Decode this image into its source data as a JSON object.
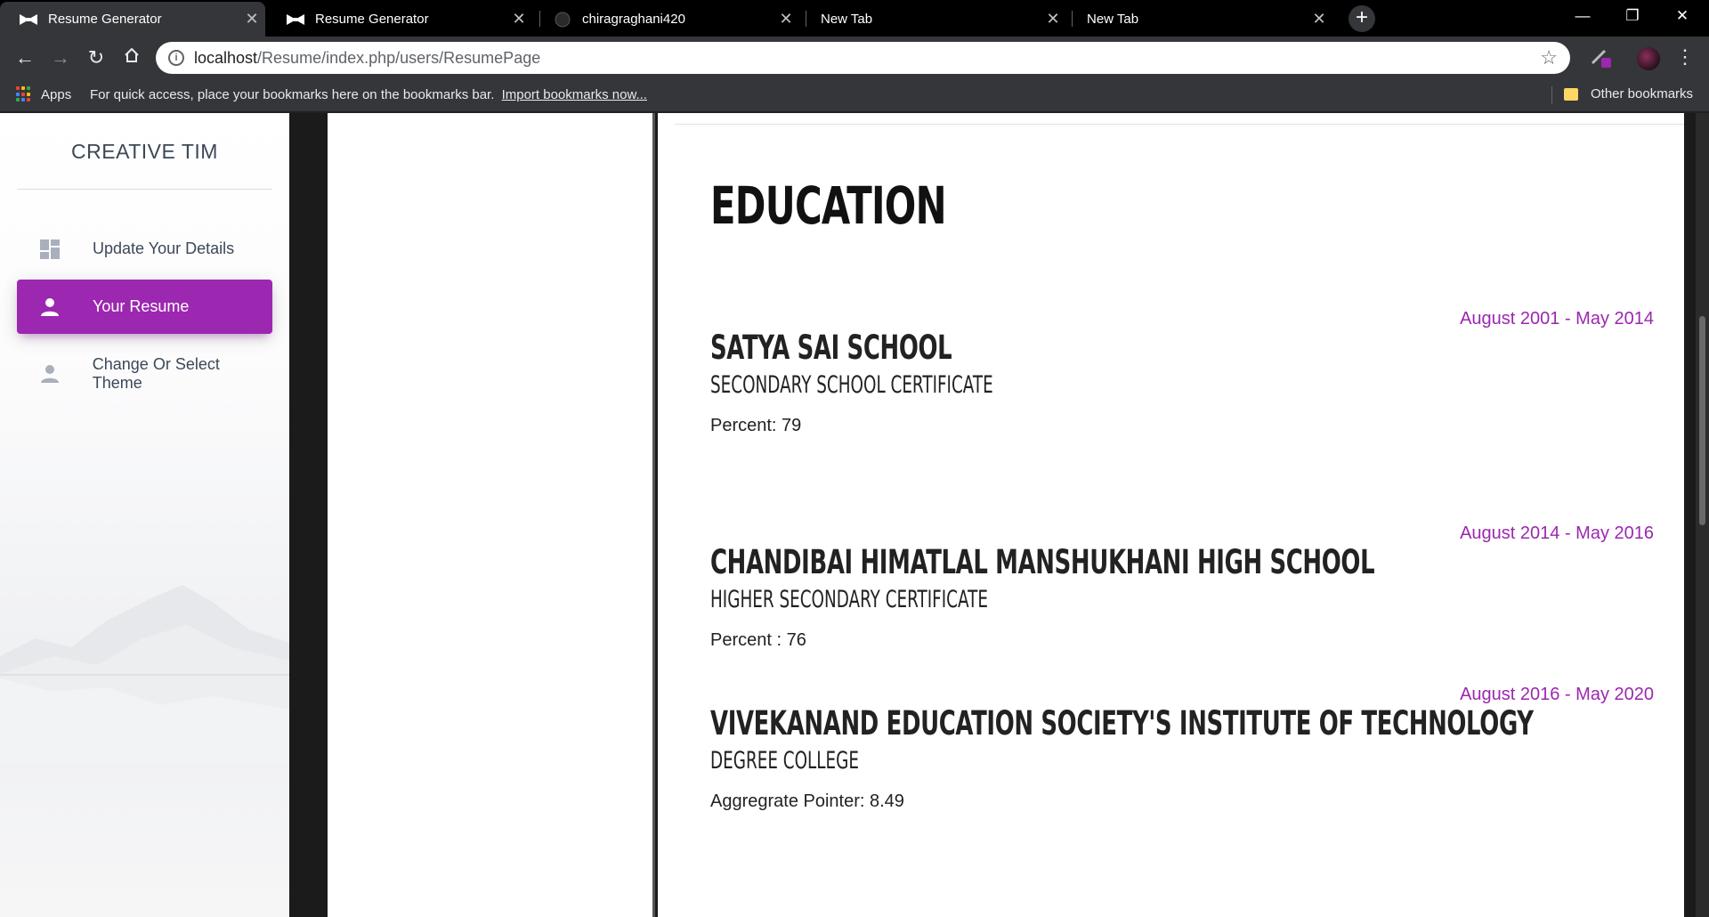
{
  "browser": {
    "tabs": [
      {
        "title": "Resume Generator",
        "active": true,
        "icon": "bowtie-icon"
      },
      {
        "title": "Resume Generator",
        "active": false,
        "icon": "bowtie-icon"
      },
      {
        "title": "chiragraghani420",
        "active": false,
        "icon": "github-icon"
      },
      {
        "title": "New Tab",
        "active": false,
        "icon": ""
      },
      {
        "title": "New Tab",
        "active": false,
        "icon": ""
      }
    ],
    "url_host": "localhost",
    "url_path": "/Resume/index.php/users/ResumePage",
    "bookmarks": {
      "apps_label": "Apps",
      "message": "For quick access, place your bookmarks here on the bookmarks bar.",
      "import_link": "Import bookmarks now...",
      "other": "Other bookmarks"
    }
  },
  "sidebar": {
    "brand": "CREATIVE TIM",
    "items": [
      {
        "label": "Update Your Details",
        "icon": "dashboard-icon",
        "active": false
      },
      {
        "label": "Your Resume",
        "icon": "person-icon",
        "active": true
      },
      {
        "label": "Change Or Select Theme",
        "icon": "person-icon",
        "active": false
      }
    ],
    "accent": "#9c27b0"
  },
  "resume": {
    "section_title": "EDUCATION",
    "education": [
      {
        "dates": "August 2001 - May 2014",
        "school": "SATYA SAI SCHOOL",
        "degree": "SECONDARY SCHOOL CERTIFICATE",
        "score": "Percent: 79"
      },
      {
        "dates": "August 2014 - May 2016",
        "school": "CHANDIBAI HIMATLAL MANSHUKHANI HIGH SCHOOL",
        "degree": "HIGHER SECONDARY CERTIFICATE",
        "score": "Percent : 76"
      },
      {
        "dates": "August 2016 - May 2020",
        "school": "VIVEKANAND EDUCATION SOCIETY'S INSTITUTE OF TECHNOLOGY",
        "degree": "DEGREE COLLEGE",
        "score": "Aggregrate Pointer: 8.49"
      }
    ],
    "date_color": "#9c27b0"
  }
}
